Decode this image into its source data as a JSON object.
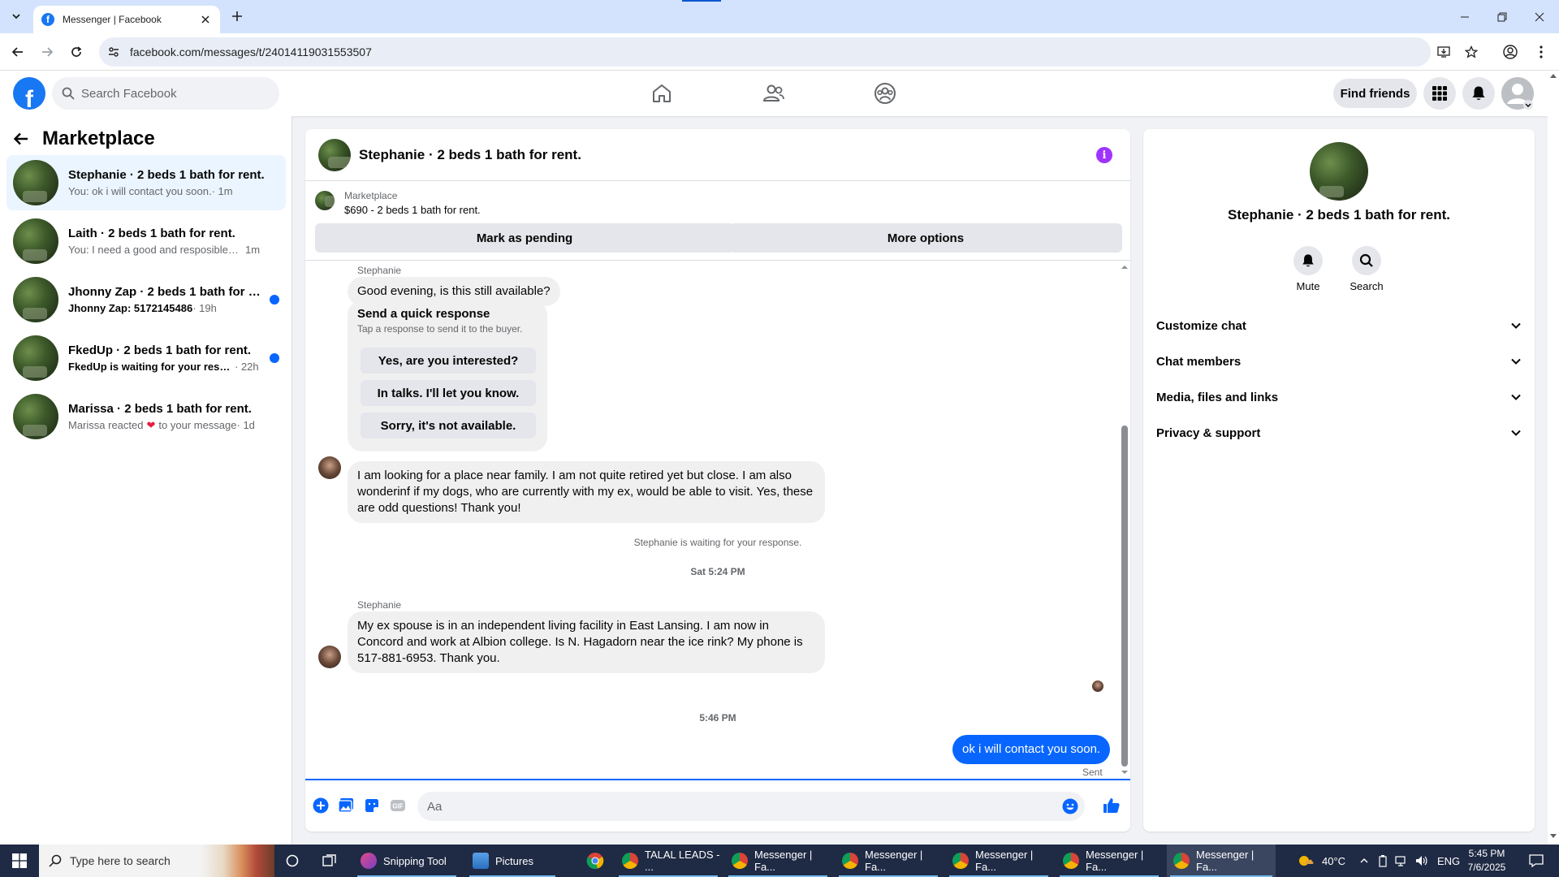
{
  "browser": {
    "tab_title": "Messenger | Facebook",
    "url": "facebook.com/messages/t/24014119031553507"
  },
  "header": {
    "search_placeholder": "Search Facebook",
    "find_friends_label": "Find friends"
  },
  "sidebar": {
    "title": "Marketplace",
    "conversations": [
      {
        "name": "Stephanie · 2 beds 1 bath for rent.",
        "preview": "You: ok i will contact you soon.",
        "time": " · 1m",
        "unread": false,
        "active": true
      },
      {
        "name": "Laith · 2 beds 1 bath for rent.",
        "preview": "You: I need a good and resposible te...",
        "time": "1m",
        "unread": false,
        "active": false
      },
      {
        "name": "Jhonny Zap · 2 beds 1 bath for re...",
        "preview": "Jhonny Zap: 5172145486",
        "time": " · 19h",
        "unread": true,
        "active": false
      },
      {
        "name": "FkedUp · 2 beds 1 bath for rent.",
        "preview": "FkedUp is waiting for your respo...",
        "time": " · 22h",
        "unread": true,
        "active": false
      },
      {
        "name": "Marissa · 2 beds 1 bath for rent.",
        "preview_before": "Marissa reacted",
        "preview_after": "to your message",
        "time": " · 1d",
        "unread": false,
        "active": false
      }
    ]
  },
  "chat": {
    "title": "Stephanie · 2 beds 1 bath for rent.",
    "marketplace_label": "Marketplace",
    "listing": "$690 - 2 beds 1 bath for rent.",
    "mark_pending_label": "Mark as pending",
    "more_options_label": "More options",
    "sender_1": "Stephanie",
    "msg_1": "Good evening, is this still available?",
    "quick_response_title": "Send a quick response",
    "quick_response_sub": "Tap a response to send it to the buyer.",
    "quick_responses": [
      "Yes, are you interested?",
      "In talks. I'll let you know.",
      "Sorry, it's not available."
    ],
    "msg_2": "I am looking for a place near family.  I am not quite retired yet but close.  I am also wonderinf if my dogs, who are currently with my ex, would be able to visit.  Yes, these are odd questions!  Thank you!",
    "waiting_note": "Stephanie is waiting for your response.",
    "time_1": "Sat 5:24 PM",
    "sender_2": "Stephanie",
    "msg_3": "My ex spouse is in an independent living facility in East Lansing.  I am now in Concord and work at Albion college.  Is N.  Hagadorn near the ice rink?  My phone is 517-881-6953.  Thank you.",
    "time_2": "5:46 PM",
    "my_msg": "ok i will contact you soon.",
    "sent_label": "Sent",
    "composer_placeholder": "Aa"
  },
  "details": {
    "name": "Stephanie · 2 beds 1 bath for rent.",
    "actions": [
      "Mute",
      "Search"
    ],
    "sections": [
      "Customize chat",
      "Chat members",
      "Media, files and links",
      "Privacy & support"
    ]
  },
  "taskbar": {
    "search_placeholder": "Type here to search",
    "apps": [
      "Snipping Tool",
      "Pictures",
      "TALAL LEADS - ...",
      "Messenger | Fa...",
      "Messenger | Fa...",
      "Messenger | Fa...",
      "Messenger | Fa...",
      "Messenger | Fa..."
    ],
    "temperature": "40°C",
    "language": "ENG",
    "time": "5:45 PM",
    "date": "7/6/2025"
  },
  "colors": {
    "facebook_blue": "#1877f2",
    "messenger_blue": "#0866ff",
    "info_purple": "#a033ff"
  }
}
